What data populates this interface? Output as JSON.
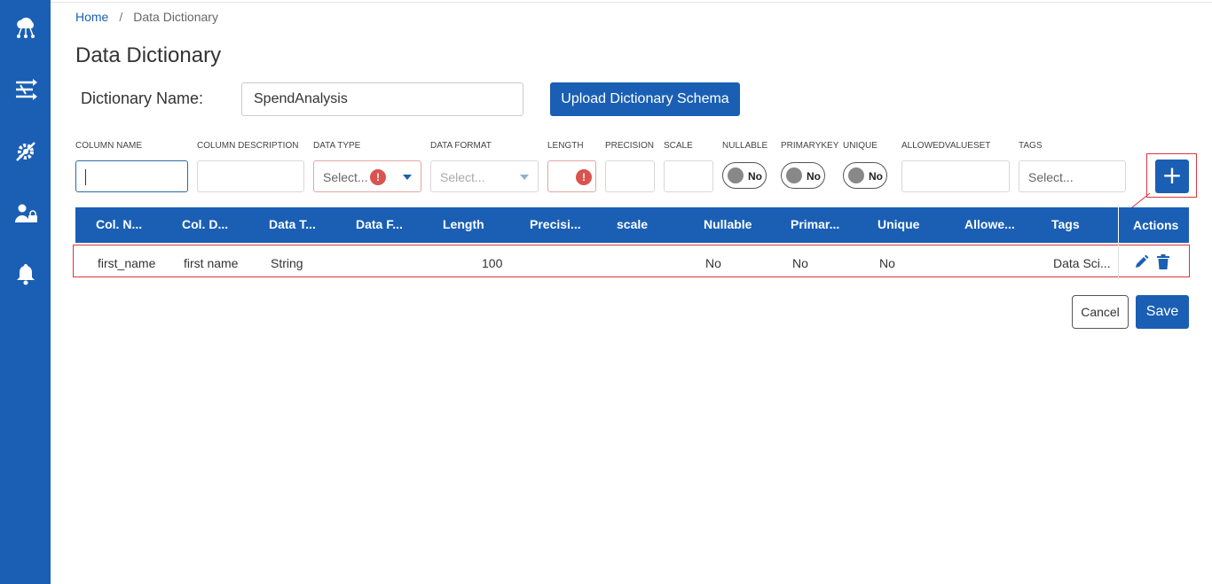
{
  "breadcrumb": {
    "home": "Home",
    "separator": "/",
    "current": "Data Dictionary"
  },
  "page_title": "Data Dictionary",
  "dictionary": {
    "label": "Dictionary Name:",
    "value": "SpendAnalysis"
  },
  "upload_button": "Upload Dictionary Schema",
  "form_labels": {
    "column_name": "COLUMN NAME",
    "column_description": "COLUMN DESCRIPTION",
    "data_type": "DATA TYPE",
    "data_format": "DATA FORMAT",
    "length": "LENGTH",
    "precision": "PRECISION",
    "scale": "SCALE",
    "nullable": "NULLABLE",
    "primarykey": "PRIMARYKEY",
    "unique": "UNIQUE",
    "allowedvalueset": "ALLOWEDVALUESET",
    "tags": "TAGS"
  },
  "form_values": {
    "data_type_placeholder": "Select...",
    "data_format_placeholder": "Select...",
    "tags_placeholder": "Select...",
    "error_glyph": "!",
    "nullable_toggle": "No",
    "primarykey_toggle": "No",
    "unique_toggle": "No",
    "add_glyph": "+"
  },
  "table": {
    "headers": [
      "Col. N...",
      "Col. D...",
      "Data T...",
      "Data F...",
      "Length",
      "Precisi...",
      "scale",
      "Nullable",
      "Primar...",
      "Unique",
      "Allowe...",
      "Tags",
      "Actions"
    ],
    "rows": [
      {
        "col_name": "first_name",
        "col_desc": "first name",
        "data_type": "String",
        "data_format": "",
        "length": "100",
        "precision": "",
        "scale": "",
        "nullable": "No",
        "primary": "No",
        "unique": "No",
        "allowed": "",
        "tags": "Data Sci..."
      }
    ]
  },
  "buttons": {
    "cancel": "Cancel",
    "save": "Save"
  },
  "icons": {
    "sidebar": [
      "cloud-network-icon",
      "shuffle-flow-icon",
      "gear-tools-icon",
      "user-lock-icon",
      "bell-icon"
    ],
    "actions": [
      "pencil-icon",
      "trash-icon"
    ]
  },
  "colors": {
    "primary": "#1a5fb4",
    "error": "#d9534f",
    "annotation": "#d9363e"
  }
}
